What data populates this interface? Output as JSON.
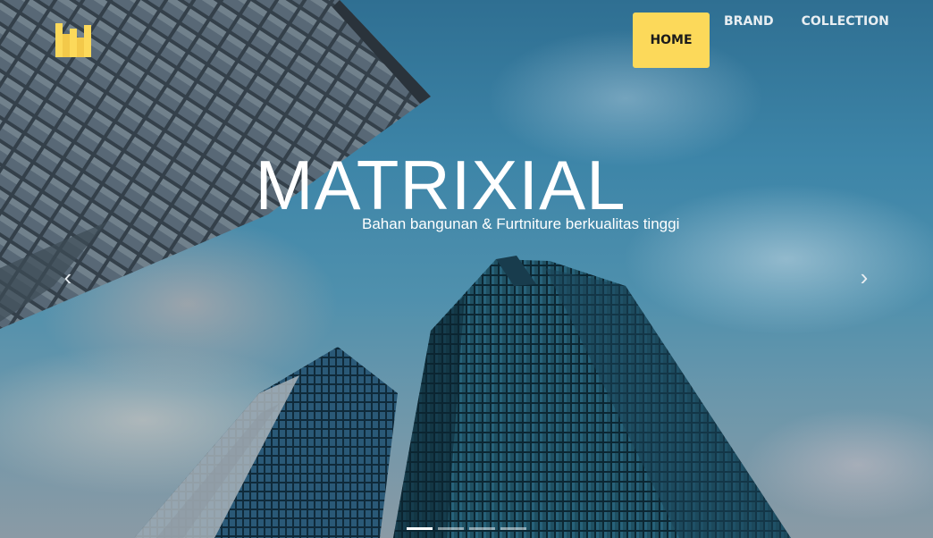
{
  "brand": {
    "logo_icon": "bar-chart-logo-icon",
    "logo_color": "#fcd95a"
  },
  "nav": {
    "items": [
      {
        "label": "HOME",
        "active": true
      },
      {
        "label": "BRAND",
        "active": false
      },
      {
        "label": "COLLECTION",
        "active": false
      }
    ],
    "active_color": "#fcd95a"
  },
  "hero": {
    "title": "MATRIXIAL",
    "subtitle": "Bahan bangunan & Furtniture berkualitas tinggi",
    "prev_icon": "chevron-left-icon",
    "next_icon": "chevron-right-icon",
    "slide_count": 4,
    "active_slide": 1
  }
}
